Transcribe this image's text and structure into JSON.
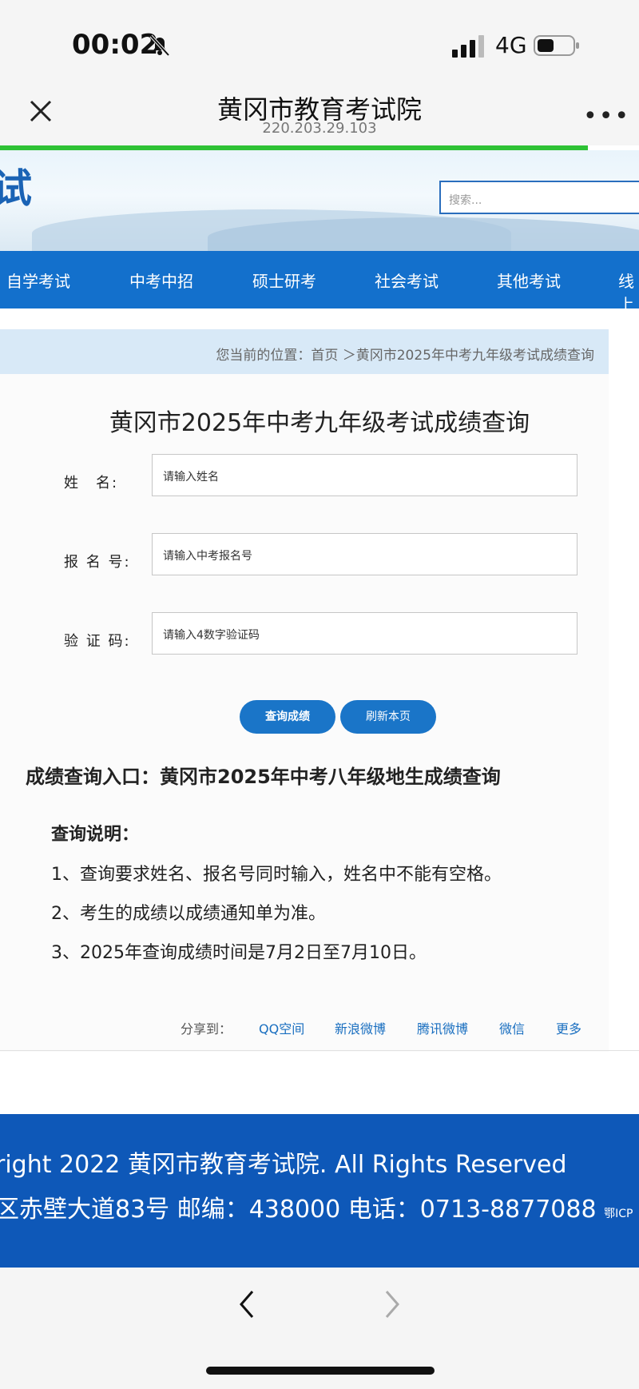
{
  "status": {
    "time": "00:02",
    "network": "4G"
  },
  "browser": {
    "title": "黄冈市教育考试院",
    "url": "220.203.29.103",
    "progress": 0.92
  },
  "banner": {
    "logo_fragment": "试",
    "search_placeholder": "搜索..."
  },
  "menu": [
    "自学考试",
    "中考中招",
    "硕士研考",
    "社会考试",
    "其他考试",
    "线上"
  ],
  "breadcrumb": "您当前的位置：首页 ＞黄冈市2025年中考九年级考试成绩查询",
  "form": {
    "title": "黄冈市2025年中考九年级考试成绩查询",
    "name_label": "姓　名:",
    "name_placeholder": "请输入姓名",
    "id_label": "报 名 号:",
    "id_placeholder": "请输入中考报名号",
    "code_label": "验 证 码:",
    "code_placeholder": "请输入4数字验证码",
    "query_button": "查询成绩",
    "refresh_button": "刷新本页"
  },
  "entry_link": "成绩查询入口：黄冈市2025年中考八年级地生成绩查询",
  "notes": {
    "title": "查询说明：",
    "items": [
      "1、查询要求姓名、报名号同时输入，姓名中不能有空格。",
      "2、考生的成绩以成绩通知单为准。",
      "3、2025年查询成绩时间是7月2日至7月10日。"
    ]
  },
  "share": {
    "label": "分享到：",
    "targets": [
      "QQ空间",
      "新浪微博",
      "腾讯微博",
      "微信",
      "更多"
    ]
  },
  "footer": {
    "line1": "right 2022 黄冈市教育考试院. All Rights Reserved",
    "line2": "区赤壁大道83号 邮编：438000 电话：0713-8877088 ",
    "icp": "鄂ICP"
  },
  "colors": {
    "brand_blue": "#1370cc",
    "progress_green": "#2ec235",
    "footer_blue": "#0e58b8"
  }
}
